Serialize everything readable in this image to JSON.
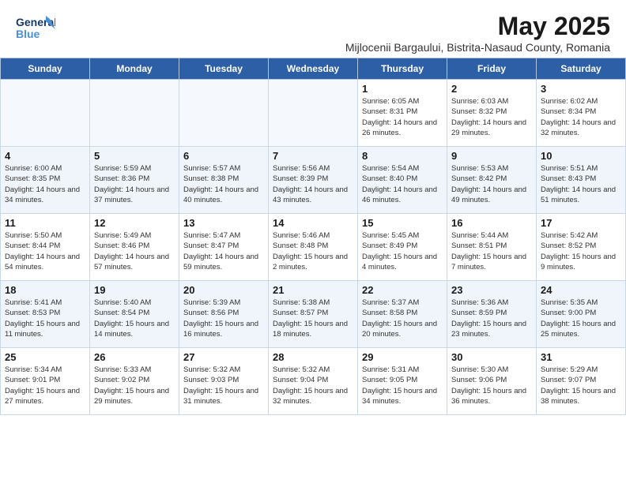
{
  "header": {
    "logo_general": "General",
    "logo_blue": "Blue",
    "month_title": "May 2025",
    "subtitle": "Mijlocenii Bargaului, Bistrita-Nasaud County, Romania"
  },
  "weekdays": [
    "Sunday",
    "Monday",
    "Tuesday",
    "Wednesday",
    "Thursday",
    "Friday",
    "Saturday"
  ],
  "weeks": [
    [
      {
        "day": "",
        "empty": true
      },
      {
        "day": "",
        "empty": true
      },
      {
        "day": "",
        "empty": true
      },
      {
        "day": "",
        "empty": true
      },
      {
        "day": "1",
        "sunrise": "6:05 AM",
        "sunset": "8:31 PM",
        "daylight": "14 hours and 26 minutes."
      },
      {
        "day": "2",
        "sunrise": "6:03 AM",
        "sunset": "8:32 PM",
        "daylight": "14 hours and 29 minutes."
      },
      {
        "day": "3",
        "sunrise": "6:02 AM",
        "sunset": "8:34 PM",
        "daylight": "14 hours and 32 minutes."
      }
    ],
    [
      {
        "day": "4",
        "sunrise": "6:00 AM",
        "sunset": "8:35 PM",
        "daylight": "14 hours and 34 minutes."
      },
      {
        "day": "5",
        "sunrise": "5:59 AM",
        "sunset": "8:36 PM",
        "daylight": "14 hours and 37 minutes."
      },
      {
        "day": "6",
        "sunrise": "5:57 AM",
        "sunset": "8:38 PM",
        "daylight": "14 hours and 40 minutes."
      },
      {
        "day": "7",
        "sunrise": "5:56 AM",
        "sunset": "8:39 PM",
        "daylight": "14 hours and 43 minutes."
      },
      {
        "day": "8",
        "sunrise": "5:54 AM",
        "sunset": "8:40 PM",
        "daylight": "14 hours and 46 minutes."
      },
      {
        "day": "9",
        "sunrise": "5:53 AM",
        "sunset": "8:42 PM",
        "daylight": "14 hours and 49 minutes."
      },
      {
        "day": "10",
        "sunrise": "5:51 AM",
        "sunset": "8:43 PM",
        "daylight": "14 hours and 51 minutes."
      }
    ],
    [
      {
        "day": "11",
        "sunrise": "5:50 AM",
        "sunset": "8:44 PM",
        "daylight": "14 hours and 54 minutes."
      },
      {
        "day": "12",
        "sunrise": "5:49 AM",
        "sunset": "8:46 PM",
        "daylight": "14 hours and 57 minutes."
      },
      {
        "day": "13",
        "sunrise": "5:47 AM",
        "sunset": "8:47 PM",
        "daylight": "14 hours and 59 minutes."
      },
      {
        "day": "14",
        "sunrise": "5:46 AM",
        "sunset": "8:48 PM",
        "daylight": "15 hours and 2 minutes."
      },
      {
        "day": "15",
        "sunrise": "5:45 AM",
        "sunset": "8:49 PM",
        "daylight": "15 hours and 4 minutes."
      },
      {
        "day": "16",
        "sunrise": "5:44 AM",
        "sunset": "8:51 PM",
        "daylight": "15 hours and 7 minutes."
      },
      {
        "day": "17",
        "sunrise": "5:42 AM",
        "sunset": "8:52 PM",
        "daylight": "15 hours and 9 minutes."
      }
    ],
    [
      {
        "day": "18",
        "sunrise": "5:41 AM",
        "sunset": "8:53 PM",
        "daylight": "15 hours and 11 minutes."
      },
      {
        "day": "19",
        "sunrise": "5:40 AM",
        "sunset": "8:54 PM",
        "daylight": "15 hours and 14 minutes."
      },
      {
        "day": "20",
        "sunrise": "5:39 AM",
        "sunset": "8:56 PM",
        "daylight": "15 hours and 16 minutes."
      },
      {
        "day": "21",
        "sunrise": "5:38 AM",
        "sunset": "8:57 PM",
        "daylight": "15 hours and 18 minutes."
      },
      {
        "day": "22",
        "sunrise": "5:37 AM",
        "sunset": "8:58 PM",
        "daylight": "15 hours and 20 minutes."
      },
      {
        "day": "23",
        "sunrise": "5:36 AM",
        "sunset": "8:59 PM",
        "daylight": "15 hours and 23 minutes."
      },
      {
        "day": "24",
        "sunrise": "5:35 AM",
        "sunset": "9:00 PM",
        "daylight": "15 hours and 25 minutes."
      }
    ],
    [
      {
        "day": "25",
        "sunrise": "5:34 AM",
        "sunset": "9:01 PM",
        "daylight": "15 hours and 27 minutes."
      },
      {
        "day": "26",
        "sunrise": "5:33 AM",
        "sunset": "9:02 PM",
        "daylight": "15 hours and 29 minutes."
      },
      {
        "day": "27",
        "sunrise": "5:32 AM",
        "sunset": "9:03 PM",
        "daylight": "15 hours and 31 minutes."
      },
      {
        "day": "28",
        "sunrise": "5:32 AM",
        "sunset": "9:04 PM",
        "daylight": "15 hours and 32 minutes."
      },
      {
        "day": "29",
        "sunrise": "5:31 AM",
        "sunset": "9:05 PM",
        "daylight": "15 hours and 34 minutes."
      },
      {
        "day": "30",
        "sunrise": "5:30 AM",
        "sunset": "9:06 PM",
        "daylight": "15 hours and 36 minutes."
      },
      {
        "day": "31",
        "sunrise": "5:29 AM",
        "sunset": "9:07 PM",
        "daylight": "15 hours and 38 minutes."
      }
    ]
  ]
}
